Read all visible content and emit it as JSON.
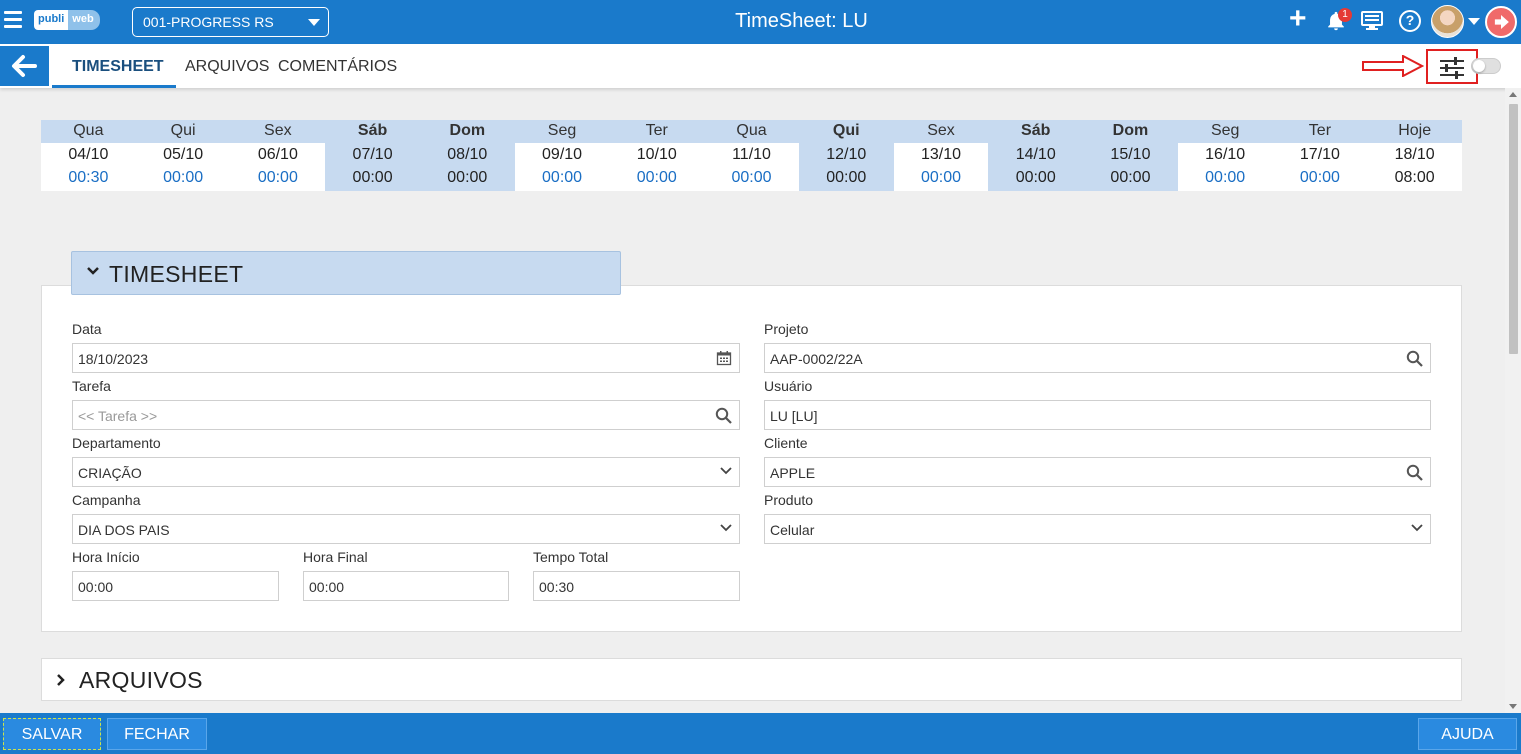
{
  "app": {
    "logo_part1": "publi",
    "logo_part2": "web",
    "company": "001-PROGRESS RS",
    "title": "TimeSheet: LU",
    "notification_count": "1"
  },
  "tabs": [
    {
      "label": "TIMESHEET",
      "active": true
    },
    {
      "label": "ARQUIVOS",
      "active": false
    },
    {
      "label": "COMENTÁRIOS",
      "active": false
    }
  ],
  "calendar": [
    {
      "weekday": "Qua",
      "date": "04/10",
      "hours": "00:30",
      "weekend": false
    },
    {
      "weekday": "Qui",
      "date": "05/10",
      "hours": "00:00",
      "weekend": false
    },
    {
      "weekday": "Sex",
      "date": "06/10",
      "hours": "00:00",
      "weekend": false
    },
    {
      "weekday": "Sáb",
      "date": "07/10",
      "hours": "00:00",
      "weekend": true
    },
    {
      "weekday": "Dom",
      "date": "08/10",
      "hours": "00:00",
      "weekend": true
    },
    {
      "weekday": "Seg",
      "date": "09/10",
      "hours": "00:00",
      "weekend": false
    },
    {
      "weekday": "Ter",
      "date": "10/10",
      "hours": "00:00",
      "weekend": false
    },
    {
      "weekday": "Qua",
      "date": "11/10",
      "hours": "00:00",
      "weekend": false
    },
    {
      "weekday": "Qui",
      "date": "12/10",
      "hours": "00:00",
      "weekend": true
    },
    {
      "weekday": "Sex",
      "date": "13/10",
      "hours": "00:00",
      "weekend": false
    },
    {
      "weekday": "Sáb",
      "date": "14/10",
      "hours": "00:00",
      "weekend": true
    },
    {
      "weekday": "Dom",
      "date": "15/10",
      "hours": "00:00",
      "weekend": true
    },
    {
      "weekday": "Seg",
      "date": "16/10",
      "hours": "00:00",
      "weekend": false
    },
    {
      "weekday": "Ter",
      "date": "17/10",
      "hours": "00:00",
      "weekend": false
    },
    {
      "weekday": "Hoje",
      "date": "18/10",
      "hours": "08:00",
      "weekend": false,
      "today": true
    }
  ],
  "timesheet_section": {
    "title": "TIMESHEET",
    "data_label": "Data",
    "data_value": "18/10/2023",
    "tarefa_label": "Tarefa",
    "tarefa_placeholder": "<< Tarefa >>",
    "departamento_label": "Departamento",
    "departamento_value": "CRIAÇÃO",
    "campanha_label": "Campanha",
    "campanha_value": "DIA DOS PAIS",
    "hora_inicio_label": "Hora Início",
    "hora_inicio_value": "00:00",
    "hora_final_label": "Hora Final",
    "hora_final_value": "00:00",
    "tempo_total_label": "Tempo Total",
    "tempo_total_value": "00:30",
    "projeto_label": "Projeto",
    "projeto_value": "AAP-0002/22A",
    "usuario_label": "Usuário",
    "usuario_value": "LU [LU]",
    "cliente_label": "Cliente",
    "cliente_value": "APPLE",
    "produto_label": "Produto",
    "produto_value": "Celular"
  },
  "arquivos_section": {
    "title": "ARQUIVOS"
  },
  "footer": {
    "save_label": "SALVAR",
    "close_label": "FECHAR",
    "help_label": "AJUDA"
  }
}
